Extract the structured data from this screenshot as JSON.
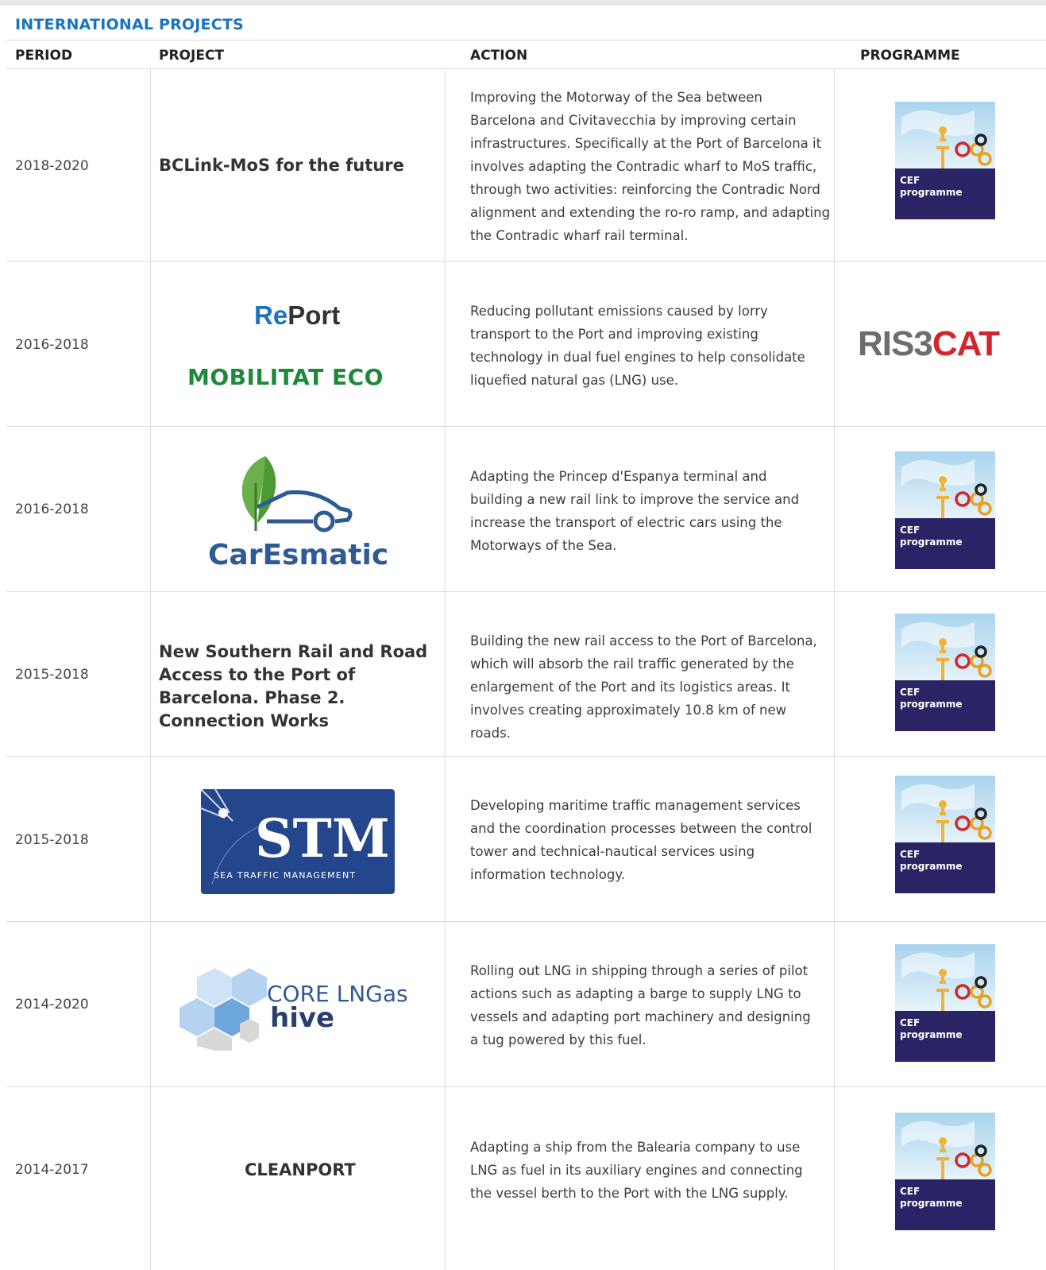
{
  "title": "INTERNATIONAL PROJECTS",
  "columns": [
    "PERIOD",
    "PROJECT",
    "ACTION",
    "PROGRAMME"
  ],
  "colors": {
    "title": "#1a73c1",
    "cef_top": "#c8e3f2",
    "cef_bottom": "#2a2466",
    "ris3cat_red": "#d0262c",
    "ris3cat_grey": "#6d6d6d",
    "eco_green": "#1c8a3a",
    "report_blue": "#1a73c1"
  },
  "rows": [
    {
      "period": "2018-2020",
      "project": "BCLink-MoS for the future",
      "action": "Improving the Motorway of the Sea between Barcelona and Civitavecchia by improving certain infrastructures. Specifically at the Port of Barcelona it involves adapting the Contradic wharf to MoS traffic, through two activities: reinforcing the Contradic Nord alignment and extending the ro-ro ramp, and adapting the Contradic wharf rail terminal.",
      "programme": "CEF programme"
    },
    {
      "period": "2016-2018",
      "project_logo": {
        "report_a": "Re",
        "report_b": "Port",
        "eco": "MOBILITAT ECO"
      },
      "action": "Reducing pollutant emissions caused by lorry transport to the Port and improving existing technology in dual fuel engines to help consolidate liquefied natural gas (LNG) use.",
      "programme_logo": {
        "a": "RIS3",
        "b": "CAT"
      }
    },
    {
      "period": "2016-2018",
      "project_logo": {
        "name": "CarEsmatic"
      },
      "action": "Adapting the Princep d'Espanya terminal and building a new rail link to improve the service and increase the transport of electric cars using the Motorways of the Sea.",
      "programme": "CEF programme"
    },
    {
      "period": "2015-2018",
      "project": "New Southern Rail and Road Access to the Port of Barcelona. Phase 2. Connection Works",
      "action": "Building the new rail access to the Port of Barcelona, which will absorb the rail traffic generated by the enlargement of the Port and its logistics areas. It involves creating approximately 10.8 km of new roads.",
      "programme": "CEF programme"
    },
    {
      "period": "2015-2018",
      "project_logo": {
        "name": "STM",
        "sub": "SEA TRAFFIC MANAGEMENT"
      },
      "action": "Developing maritime traffic management services and the coordination processes between the control tower and technical-nautical services using information technology.",
      "programme": "CEF programme"
    },
    {
      "period": "2014-2020",
      "project_logo": {
        "line1": "CORE LNGas",
        "line2": "hive"
      },
      "action": "Rolling out LNG in shipping through a series of pilot actions such as adapting a barge to supply LNG to vessels and adapting port machinery and designing a tug powered by this fuel.",
      "programme": "CEF programme"
    },
    {
      "period": "2014-2017",
      "project": "CLEANPORT",
      "action": "Adapting a ship from the Balearia company to use LNG as fuel in its auxiliary engines and connecting the vessel berth to the Port with the LNG supply.",
      "programme": "CEF programme"
    }
  ]
}
